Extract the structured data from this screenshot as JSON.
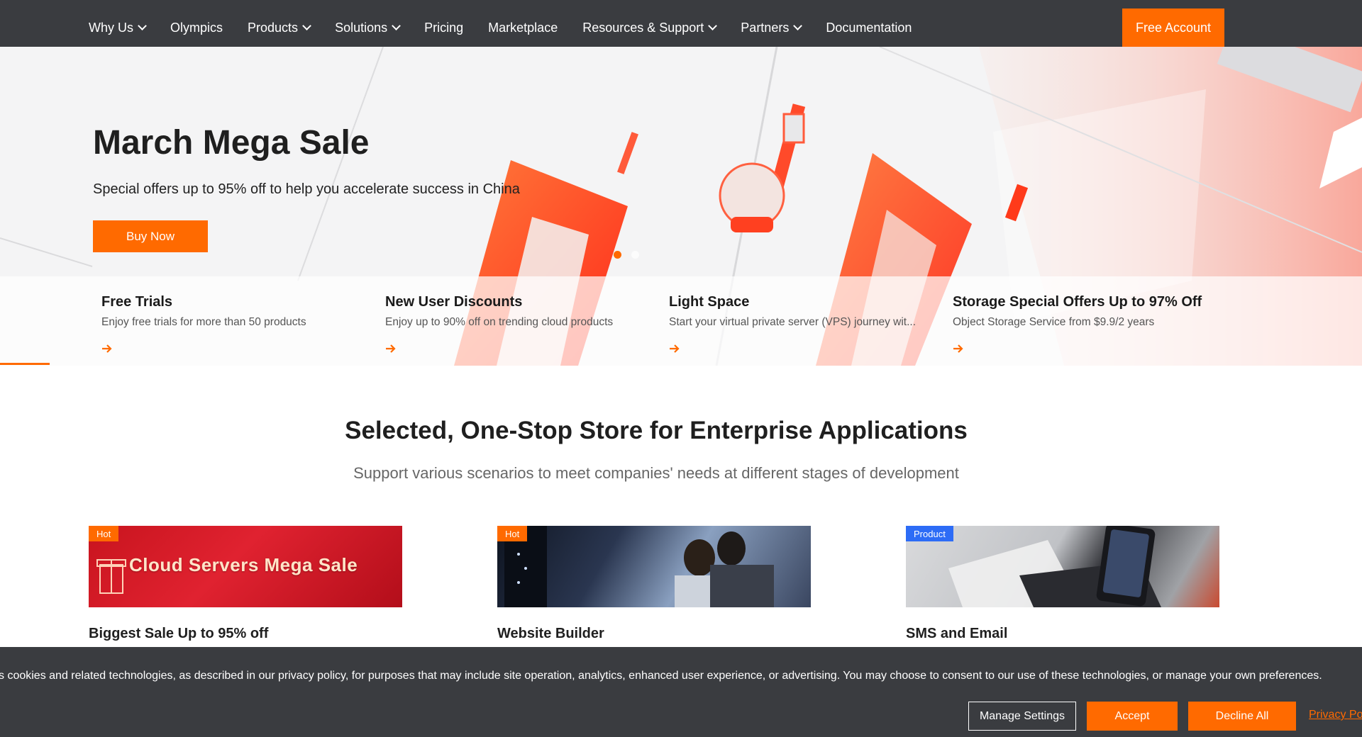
{
  "nav": {
    "items": [
      {
        "label": "Why Us",
        "dropdown": true
      },
      {
        "label": "Olympics",
        "dropdown": false
      },
      {
        "label": "Products",
        "dropdown": true
      },
      {
        "label": "Solutions",
        "dropdown": true
      },
      {
        "label": "Pricing",
        "dropdown": false
      },
      {
        "label": "Marketplace",
        "dropdown": false
      },
      {
        "label": "Resources & Support",
        "dropdown": true
      },
      {
        "label": "Partners",
        "dropdown": true
      },
      {
        "label": "Documentation",
        "dropdown": false
      }
    ],
    "cta_label": "Free Account"
  },
  "hero": {
    "title": "March Mega Sale",
    "subtitle": "Special offers up to 95% off to help you accelerate success in China",
    "button_label": "Buy Now",
    "carousel": {
      "slides": 2,
      "active_index": 0
    }
  },
  "promos": [
    {
      "title": "Free Trials",
      "description": "Enjoy free trials for more than 50 products"
    },
    {
      "title": "New User Discounts",
      "description": "Enjoy up to 90% off on trending cloud products"
    },
    {
      "title": "Light Space",
      "description": "Start your virtual private server (VPS) journey wit..."
    },
    {
      "title": "Storage Special Offers Up to 97% Off",
      "description": "Object Storage Service from $9.9/2 years"
    }
  ],
  "section": {
    "title": "Selected, One-Stop Store for Enterprise Applications",
    "subtitle": "Support various scenarios to meet companies' needs at different stages of development"
  },
  "cards": [
    {
      "badge": "Hot",
      "badge_type": "hot",
      "image_text": "Cloud Servers Mega Sale",
      "title": "Biggest Sale Up to 95% off"
    },
    {
      "badge": "Hot",
      "badge_type": "hot",
      "image_text": "",
      "title": "Website Builder"
    },
    {
      "badge": "Product",
      "badge_type": "product",
      "image_text": "",
      "title": "SMS and Email"
    }
  ],
  "cookie": {
    "text": "s cookies and related technologies, as described in our privacy policy, for purposes that may include site operation, analytics, enhanced user experience, or advertising. You may choose to consent to our use of these technologies, or manage your own preferences.",
    "manage_label": "Manage Settings",
    "accept_label": "Accept",
    "decline_label": "Decline All",
    "privacy_label": "Privacy Po"
  },
  "colors": {
    "accent": "#ff6a00",
    "nav_bg": "#3a3c40",
    "badge_product": "#2d6cf6"
  }
}
